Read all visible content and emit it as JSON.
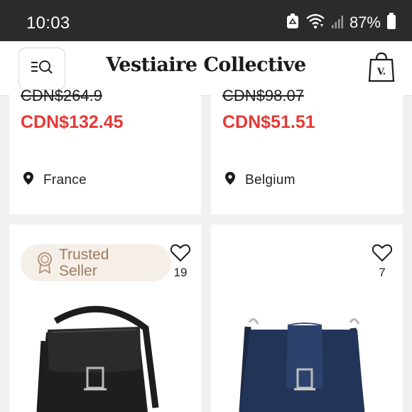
{
  "status_bar": {
    "time": "10:03",
    "battery_percent": "87%",
    "icons": [
      "recycle-notification-icon",
      "wifi-icon",
      "cellular-signal-icon",
      "battery-icon"
    ]
  },
  "header": {
    "brand": "Vestiaire Collective",
    "menu_icon": "menu-search-icon",
    "cart_icon": "shopping-bag-icon",
    "cart_badge": "V."
  },
  "colors": {
    "sale_price": "#e53935",
    "badge_bg": "#f6efe7",
    "badge_text": "#9a7b63",
    "status_bar": "#2b2b2b"
  },
  "products": [
    {
      "old_price": "CDN$264.9",
      "price": "CDN$132.45",
      "location": "France"
    },
    {
      "old_price": "CDN$98.07",
      "price": "CDN$51.51",
      "location": "Belgium"
    },
    {
      "badge": "Trusted Seller",
      "likes": "19",
      "image": "black-leather-crossbody-bag"
    },
    {
      "likes": "7",
      "image": "navy-leather-shoulder-bag"
    }
  ]
}
